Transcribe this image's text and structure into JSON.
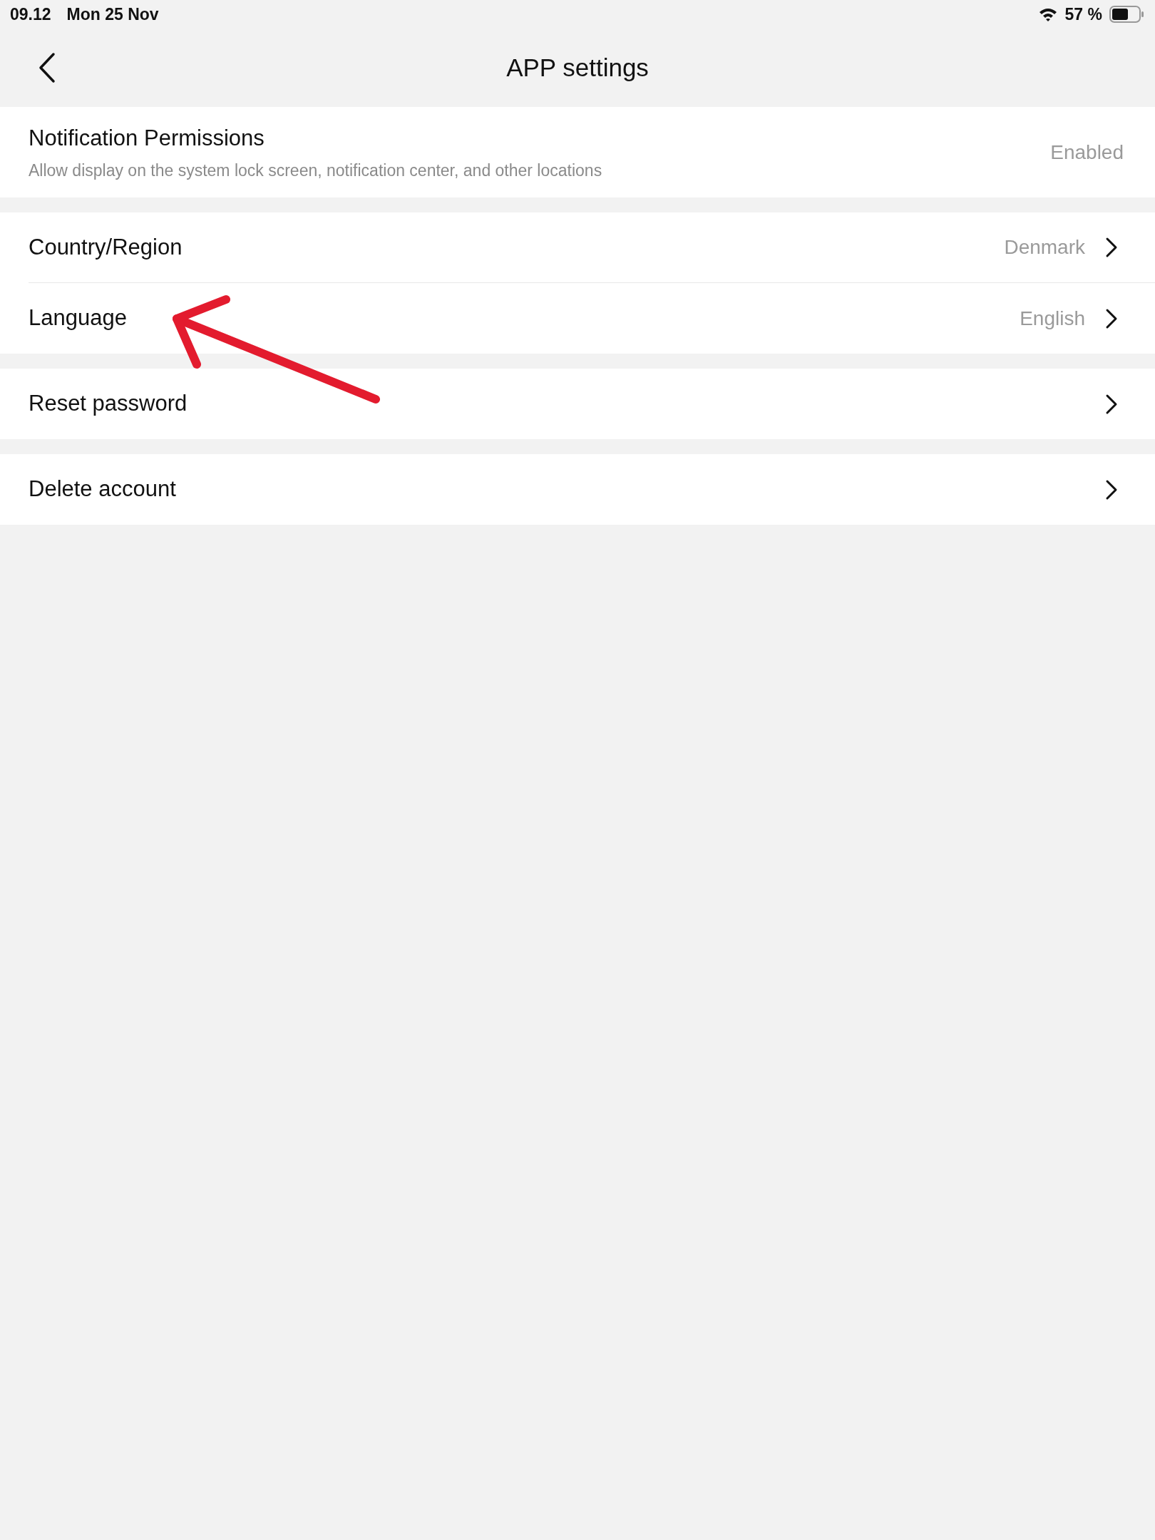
{
  "status_bar": {
    "time": "09.12",
    "date": "Mon 25 Nov",
    "battery": "57 %"
  },
  "header": {
    "title": "APP settings"
  },
  "sections": [
    {
      "rows": [
        {
          "kind": "info",
          "label": "Notification Permissions",
          "subtitle": "Allow display on the system lock screen, notification center, and other locations",
          "value": "Enabled"
        }
      ]
    },
    {
      "rows": [
        {
          "kind": "link",
          "label": "Country/Region",
          "value": "Denmark"
        },
        {
          "kind": "link",
          "label": "Language",
          "value": "English"
        }
      ]
    },
    {
      "rows": [
        {
          "kind": "link",
          "label": "Reset password"
        }
      ]
    },
    {
      "rows": [
        {
          "kind": "link",
          "label": "Delete account"
        }
      ]
    }
  ]
}
